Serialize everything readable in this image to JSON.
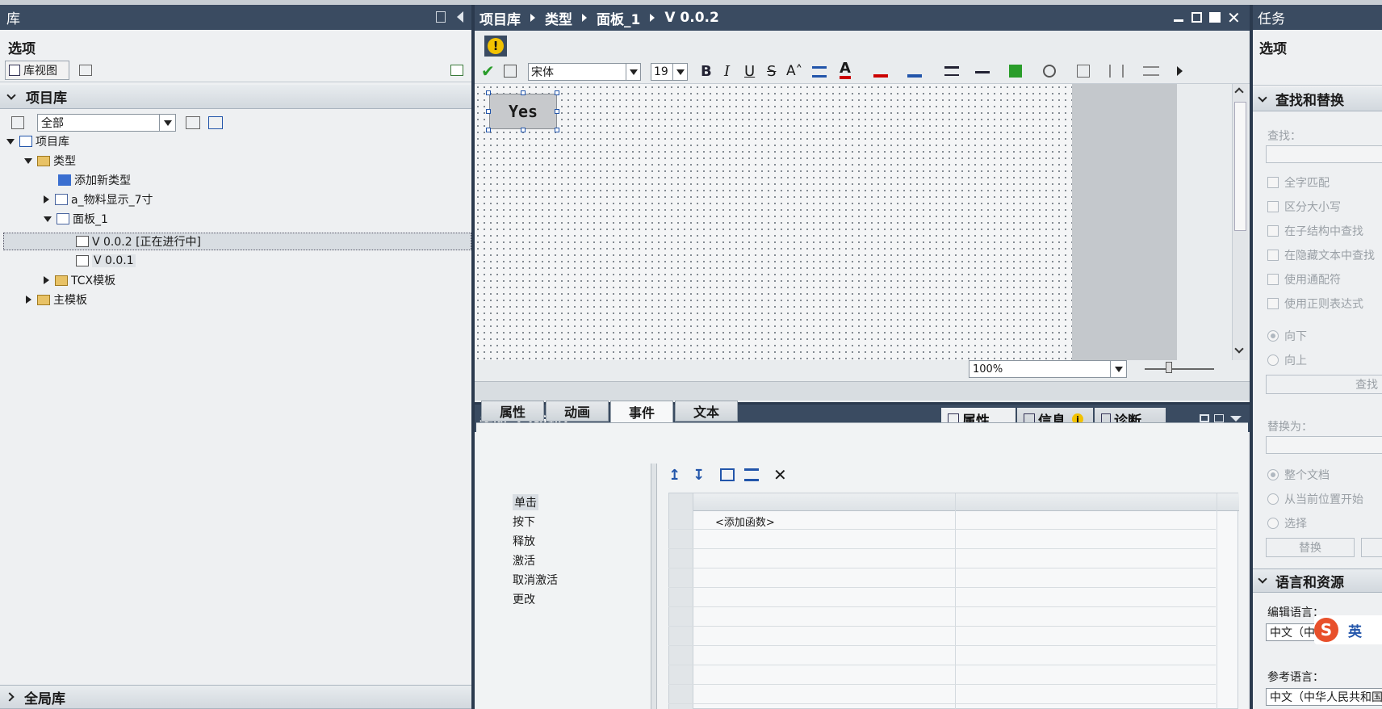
{
  "library": {
    "title": "库",
    "options_label": "选项",
    "view_label": "库视图",
    "project_lib_header": "项目库",
    "filter_value": "全部",
    "tree": [
      {
        "label": "项目库"
      },
      {
        "label": "类型"
      },
      {
        "label": "添加新类型"
      },
      {
        "label": "a_物料显示_7寸"
      },
      {
        "label": "面板_1"
      },
      {
        "label": "V 0.0.2 [正在进行中]"
      },
      {
        "label": "V 0.0.1"
      },
      {
        "label": "TCX模板"
      },
      {
        "label": "主模板"
      }
    ],
    "global_lib_header": "全局库"
  },
  "editor": {
    "breadcrumb": [
      "项目库",
      "类型",
      "面板_1",
      "V 0.0.2"
    ],
    "font_name": "宋体",
    "font_size": "19",
    "canvas_button_text": "Yes",
    "zoom": "100%"
  },
  "inspector": {
    "title": "关闭_1 [按钮]",
    "right_tabs": [
      "属性",
      "信息",
      "诊断"
    ],
    "tabs": [
      "属性",
      "动画",
      "事件",
      "文本"
    ],
    "events": [
      "单击",
      "按下",
      "释放",
      "激活",
      "取消激活",
      "更改"
    ],
    "add_function": "<添加函数>"
  },
  "tasks": {
    "title": "任务",
    "options_label": "选项",
    "find_replace_header": "查找和替换",
    "find_label": "查找：",
    "checkboxes": [
      "全字匹配",
      "区分大小写",
      "在子结构中查找",
      "在隐藏文本中查找",
      "使用通配符",
      "使用正则表达式"
    ],
    "direction": [
      "向下",
      "向上"
    ],
    "find_button": "查找",
    "replace_label": "替换为：",
    "scope": [
      "整个文档",
      "从当前位置开始",
      "选择"
    ],
    "replace_button": "替换",
    "lang_header": "语言和资源",
    "edit_lang_label": "编辑语言：",
    "edit_lang_value": "中文（中",
    "ime_label": "英",
    "ref_lang_label": "参考语言：",
    "ref_lang_value": "中文（中华人民共和国"
  },
  "colors": {
    "accent": "#3a4b61",
    "panel": "#eef0f2",
    "warning": "#f2c200"
  }
}
